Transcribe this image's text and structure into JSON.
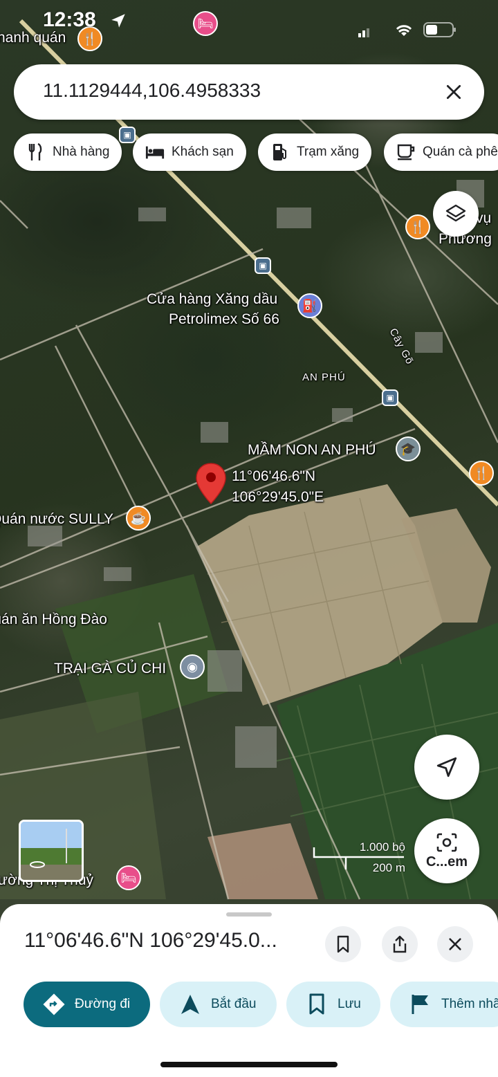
{
  "status_bar": {
    "time": "12:38",
    "location_icon": "location-arrow-icon",
    "signal_icon": "cellular-signal-icon",
    "wifi_icon": "wifi-icon",
    "battery_icon": "battery-icon"
  },
  "search": {
    "query": "11.1129444,106.4958333",
    "clear_icon": "close-icon"
  },
  "chips": [
    {
      "label": "Nhà hàng",
      "icon": "restaurant-icon"
    },
    {
      "label": "Khách sạn",
      "icon": "hotel-icon"
    },
    {
      "label": "Trạm xăng",
      "icon": "gas-station-icon"
    },
    {
      "label": "Quán cà phê",
      "icon": "coffee-icon"
    }
  ],
  "map": {
    "labels": {
      "top_left_place": "nanh quán",
      "petrol_station_line1": "Cửa hàng Xăng dầu",
      "petrol_station_line2": "Petrolimex Số 66",
      "an_phu": "AN PHÚ",
      "cay_go": "Cây Gõ",
      "mam_non": "MẦM NON AN PHÚ",
      "pin_lat": "11°06'46.6\"N",
      "pin_lng": "106°29'45.0\"E",
      "quan_nuoc": "Quán nước SULLY",
      "hong_dao": "Quán ăn Hồng Đào",
      "trai_ga": "TRẠI GÀ CỦ CHI",
      "truong": "Trường Thị Thuỷ",
      "top_right_line1": "vụ",
      "top_right_line2": "Phương"
    },
    "scale": {
      "top": "1.000 bộ",
      "bottom": "200 m"
    },
    "camera_label": "C...em"
  },
  "sheet": {
    "title": "11°06'46.6\"N 106°29'45.0...",
    "actions": [
      {
        "label": "Đường đi",
        "icon": "directions-icon"
      },
      {
        "label": "Bắt đầu",
        "icon": "navigation-arrow-icon"
      },
      {
        "label": "Lưu",
        "icon": "bookmark-icon"
      },
      {
        "label": "Thêm nhã",
        "icon": "flag-icon"
      }
    ]
  },
  "colors": {
    "primary": "#0c6b7e",
    "secondary_bg": "#d9f1f7",
    "pin": "#e53935",
    "poi_orange": "#f08a24",
    "poi_pink": "#e84e8a"
  }
}
